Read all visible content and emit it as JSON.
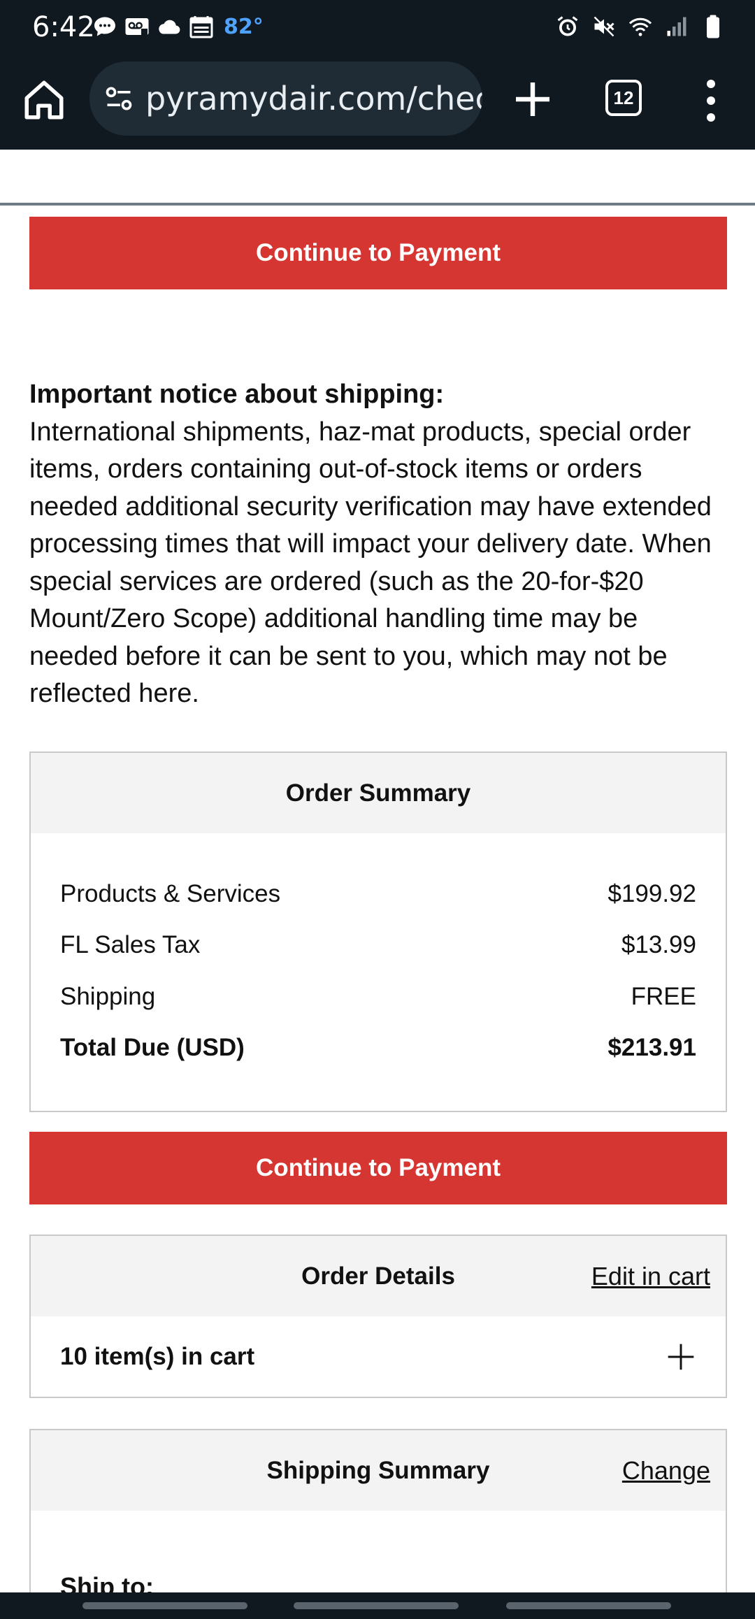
{
  "status_bar": {
    "time": "6:42",
    "temperature": "82°",
    "left_icons": [
      "chat-bubble-icon",
      "voicemail-icon",
      "cloud-icon",
      "calendar-icon"
    ],
    "right_icons": [
      "alarm-icon",
      "mute-icon",
      "wifi-icon",
      "signal-icon",
      "battery-icon"
    ]
  },
  "browser": {
    "url": "pyramydair.com/checkout",
    "tab_count": "12"
  },
  "page": {
    "continue_button_top": "Continue to Payment",
    "notice_title": "Important notice about shipping:",
    "notice_body": "International shipments, haz-mat products, special order items, orders containing out-of-stock items or orders needed additional security verification may have extended processing times that will impact your delivery date. When special services are ordered (such as the 20-for-$20 Mount/Zero Scope) additional handling time may be needed before it can be sent to you, which may not be reflected here.",
    "order_summary": {
      "title": "Order Summary",
      "rows": [
        {
          "label": "Products & Services",
          "value": "$199.92"
        },
        {
          "label": "FL Sales Tax",
          "value": "$13.99"
        },
        {
          "label": "Shipping",
          "value": "FREE"
        }
      ],
      "total": {
        "label": "Total Due (USD)",
        "value": "$213.91"
      }
    },
    "continue_button_bottom": "Continue to Payment",
    "order_details": {
      "title": "Order Details",
      "edit_link": "Edit in cart",
      "items_label": "10 item(s) in cart"
    },
    "shipping_summary": {
      "title": "Shipping Summary",
      "change_link": "Change",
      "ship_to_label": "Ship to:"
    }
  },
  "colors": {
    "primary_button": "#d63632",
    "system_bar": "#101820",
    "panel_header": "#f3f3f3"
  }
}
